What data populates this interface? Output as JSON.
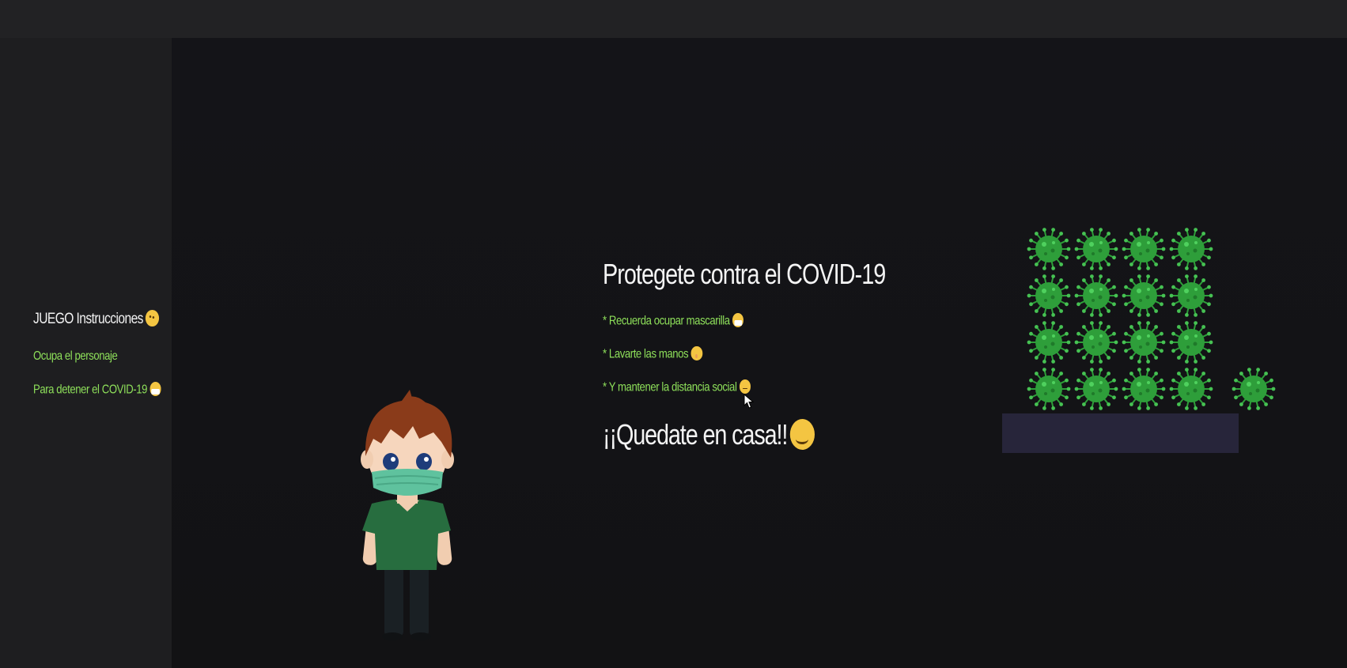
{
  "sidebar": {
    "title": "JUEGO Instrucciones",
    "title_emoji": "smirk-emoji",
    "lines": [
      {
        "text": "Ocupa el personaje"
      },
      {
        "text": "Para detener el COVID-19",
        "emoji": "mask-emoji"
      }
    ]
  },
  "main": {
    "title": "Protegete contra el COVID-19",
    "tips": [
      {
        "text": "* Recuerda ocupar mascarilla",
        "emoji": "mask-emoji"
      },
      {
        "text": "* Lavarte las manos",
        "emoji": "shushing-emoji"
      },
      {
        "text": "* Y mantener la distancia social",
        "emoji": "neutral-emoji"
      }
    ],
    "stay_home": "¡¡Quedate en casa!!",
    "stay_home_emoji": "smile-emoji"
  },
  "game": {
    "player": "masked-boy-character",
    "enemy": "coronavirus-sprite",
    "virus_grid": {
      "rows": 4,
      "cols": 4
    },
    "stray_viruses": 1,
    "colors": {
      "virus": "#2e9e3a",
      "platform": "#27253a",
      "accent_text": "#8ee05a"
    }
  }
}
